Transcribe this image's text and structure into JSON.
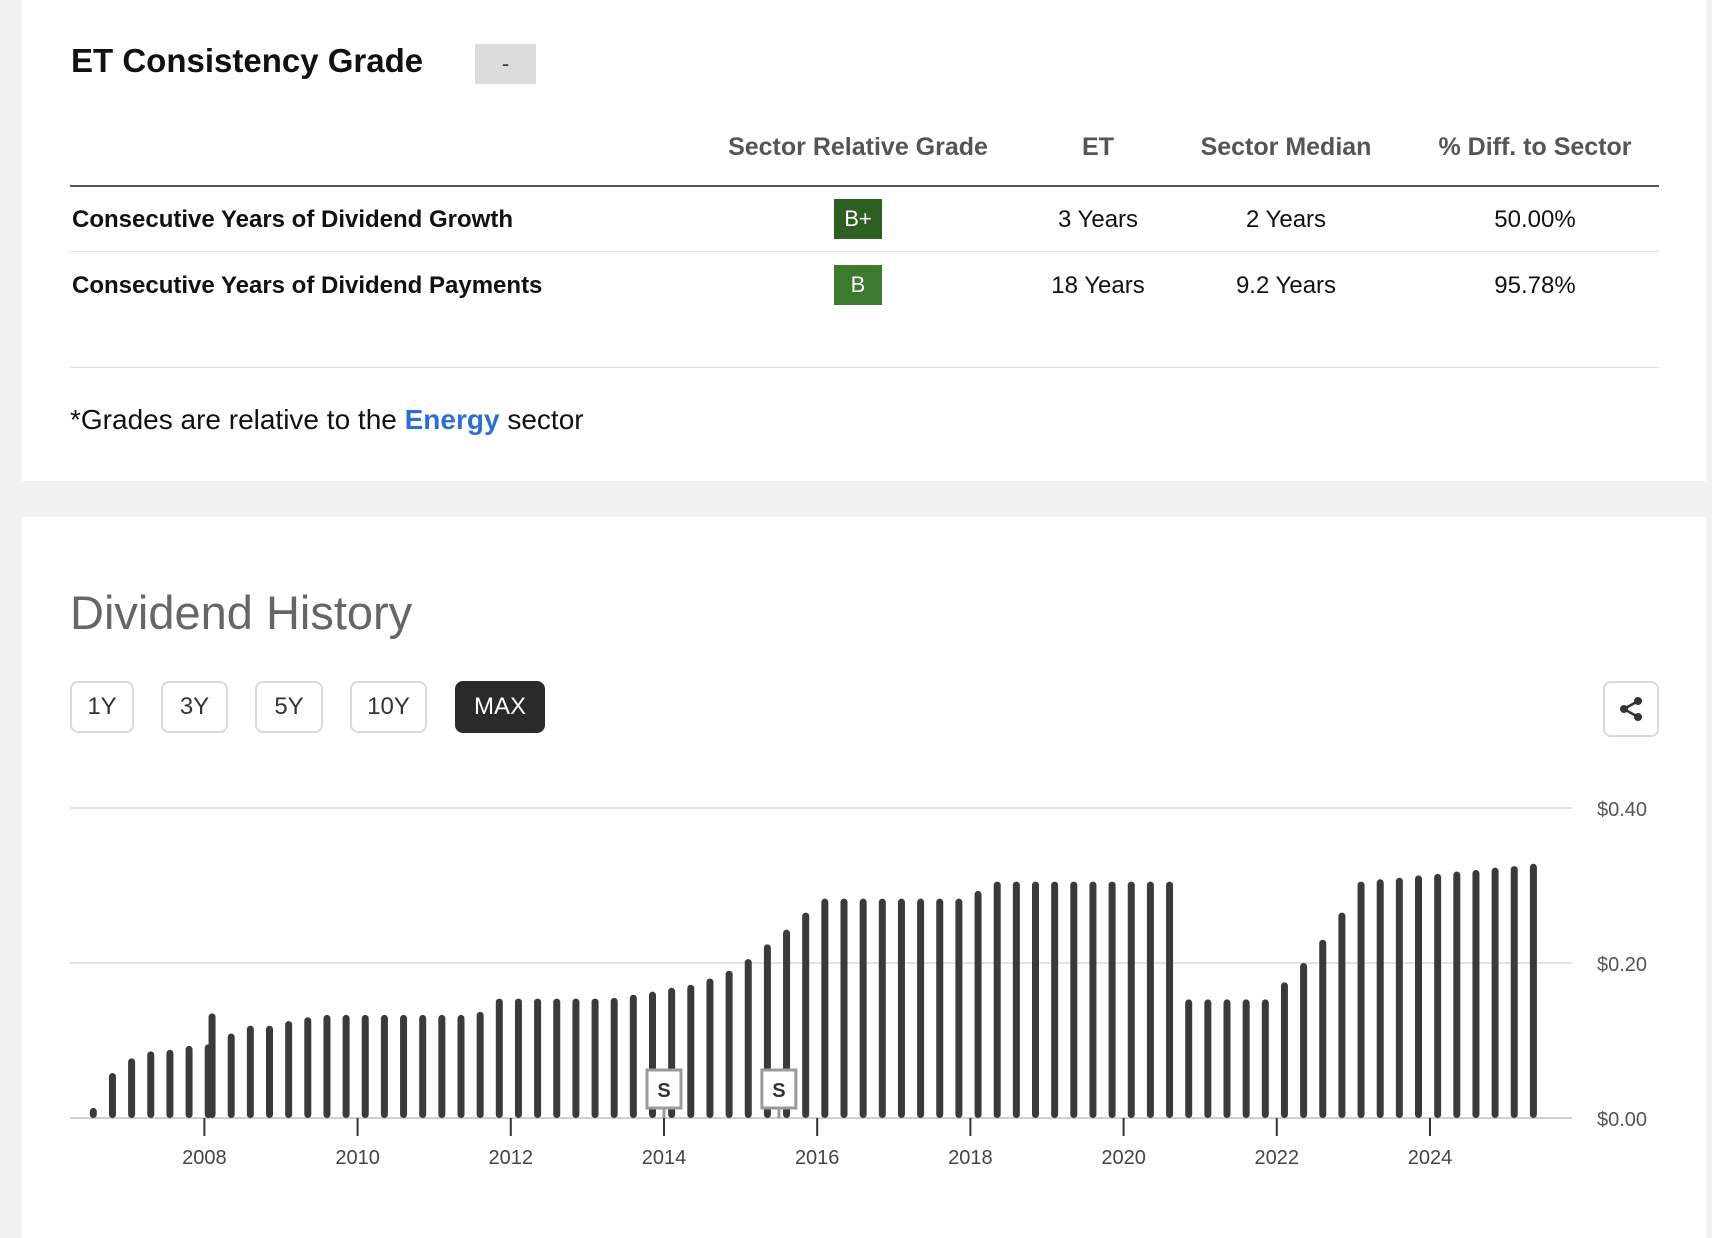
{
  "grade_card": {
    "title": "ET Consistency Grade",
    "overall_grade": "-",
    "columns": [
      "Sector Relative Grade",
      "ET",
      "Sector Median",
      "% Diff. to Sector"
    ],
    "rows": [
      {
        "label": "Consecutive Years of Dividend Growth",
        "grade": "B+",
        "grade_color": "#2e5f22",
        "et": "3 Years",
        "median": "2 Years",
        "diff": "50.00%"
      },
      {
        "label": "Consecutive Years of Dividend Payments",
        "grade": "B",
        "grade_color": "#3c7a2d",
        "et": "18 Years",
        "median": "9.2 Years",
        "diff": "95.78%"
      }
    ],
    "note_prefix": "*Grades are relative to the ",
    "note_link": "Energy",
    "note_suffix": " sector"
  },
  "history_card": {
    "title": "Dividend History",
    "ranges": [
      {
        "label": "1Y",
        "active": false
      },
      {
        "label": "3Y",
        "active": false
      },
      {
        "label": "5Y",
        "active": false
      },
      {
        "label": "10Y",
        "active": false
      },
      {
        "label": "MAX",
        "active": true
      }
    ],
    "share_icon": "share-icon"
  },
  "chart_data": {
    "type": "bar",
    "x_label_years": [
      "2008",
      "2010",
      "2012",
      "2014",
      "2016",
      "2018",
      "2020",
      "2022",
      "2024"
    ],
    "y_ticks": [
      "$0.00",
      "$0.20",
      "$0.40"
    ],
    "ylim": [
      0,
      0.4
    ],
    "bar_color": "#3a3a3d",
    "grid": true,
    "split_markers": [
      {
        "label": "S",
        "date": 2014.0
      },
      {
        "label": "S",
        "date": 2015.5
      }
    ],
    "points": [
      {
        "x": 2006.55,
        "y": 0.013
      },
      {
        "x": 2006.8,
        "y": 0.058
      },
      {
        "x": 2007.05,
        "y": 0.077
      },
      {
        "x": 2007.3,
        "y": 0.086
      },
      {
        "x": 2007.55,
        "y": 0.088
      },
      {
        "x": 2007.8,
        "y": 0.093
      },
      {
        "x": 2008.05,
        "y": 0.095
      },
      {
        "x": 2008.1,
        "y": 0.135
      },
      {
        "x": 2008.35,
        "y": 0.109
      },
      {
        "x": 2008.6,
        "y": 0.119
      },
      {
        "x": 2008.85,
        "y": 0.119
      },
      {
        "x": 2009.1,
        "y": 0.125
      },
      {
        "x": 2009.35,
        "y": 0.13
      },
      {
        "x": 2009.6,
        "y": 0.133
      },
      {
        "x": 2009.85,
        "y": 0.133
      },
      {
        "x": 2010.1,
        "y": 0.133
      },
      {
        "x": 2010.35,
        "y": 0.133
      },
      {
        "x": 2010.6,
        "y": 0.133
      },
      {
        "x": 2010.85,
        "y": 0.133
      },
      {
        "x": 2011.1,
        "y": 0.133
      },
      {
        "x": 2011.35,
        "y": 0.133
      },
      {
        "x": 2011.6,
        "y": 0.137
      },
      {
        "x": 2011.85,
        "y": 0.154
      },
      {
        "x": 2012.1,
        "y": 0.154
      },
      {
        "x": 2012.35,
        "y": 0.154
      },
      {
        "x": 2012.6,
        "y": 0.154
      },
      {
        "x": 2012.85,
        "y": 0.154
      },
      {
        "x": 2013.1,
        "y": 0.154
      },
      {
        "x": 2013.35,
        "y": 0.155
      },
      {
        "x": 2013.6,
        "y": 0.159
      },
      {
        "x": 2013.85,
        "y": 0.163
      },
      {
        "x": 2014.1,
        "y": 0.168
      },
      {
        "x": 2014.35,
        "y": 0.172
      },
      {
        "x": 2014.6,
        "y": 0.18
      },
      {
        "x": 2014.85,
        "y": 0.19
      },
      {
        "x": 2015.1,
        "y": 0.205
      },
      {
        "x": 2015.35,
        "y": 0.224
      },
      {
        "x": 2015.6,
        "y": 0.243
      },
      {
        "x": 2015.85,
        "y": 0.265
      },
      {
        "x": 2016.1,
        "y": 0.283
      },
      {
        "x": 2016.35,
        "y": 0.283
      },
      {
        "x": 2016.6,
        "y": 0.283
      },
      {
        "x": 2016.85,
        "y": 0.283
      },
      {
        "x": 2017.1,
        "y": 0.283
      },
      {
        "x": 2017.35,
        "y": 0.283
      },
      {
        "x": 2017.6,
        "y": 0.283
      },
      {
        "x": 2017.85,
        "y": 0.283
      },
      {
        "x": 2018.1,
        "y": 0.293
      },
      {
        "x": 2018.35,
        "y": 0.305
      },
      {
        "x": 2018.6,
        "y": 0.305
      },
      {
        "x": 2018.85,
        "y": 0.305
      },
      {
        "x": 2019.1,
        "y": 0.305
      },
      {
        "x": 2019.35,
        "y": 0.305
      },
      {
        "x": 2019.6,
        "y": 0.305
      },
      {
        "x": 2019.85,
        "y": 0.305
      },
      {
        "x": 2020.1,
        "y": 0.305
      },
      {
        "x": 2020.35,
        "y": 0.305
      },
      {
        "x": 2020.6,
        "y": 0.305
      },
      {
        "x": 2020.85,
        "y": 0.153
      },
      {
        "x": 2021.1,
        "y": 0.153
      },
      {
        "x": 2021.35,
        "y": 0.153
      },
      {
        "x": 2021.6,
        "y": 0.153
      },
      {
        "x": 2021.85,
        "y": 0.153
      },
      {
        "x": 2022.1,
        "y": 0.175
      },
      {
        "x": 2022.35,
        "y": 0.2
      },
      {
        "x": 2022.6,
        "y": 0.23
      },
      {
        "x": 2022.85,
        "y": 0.265
      },
      {
        "x": 2023.1,
        "y": 0.305
      },
      {
        "x": 2023.35,
        "y": 0.308
      },
      {
        "x": 2023.6,
        "y": 0.31
      },
      {
        "x": 2023.85,
        "y": 0.313
      },
      {
        "x": 2024.1,
        "y": 0.315
      },
      {
        "x": 2024.35,
        "y": 0.318
      },
      {
        "x": 2024.6,
        "y": 0.32
      },
      {
        "x": 2024.85,
        "y": 0.323
      },
      {
        "x": 2025.1,
        "y": 0.325
      },
      {
        "x": 2025.35,
        "y": 0.328
      }
    ]
  }
}
